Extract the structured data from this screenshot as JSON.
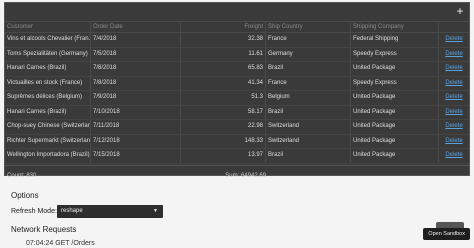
{
  "toolbar": {
    "add_label": "+"
  },
  "grid": {
    "columns": [
      "Customer",
      "Order Date",
      "Freight",
      "Ship Country",
      "Shipping Company",
      ""
    ],
    "rows": [
      {
        "customer": "Vins et alcools Chevalier (Fran...",
        "date": "7/4/2018",
        "freight": "32.38",
        "country": "France",
        "company": "Federal Shipping",
        "action": "Delete"
      },
      {
        "customer": "Toms Spezialitäten (Germany)",
        "date": "7/5/2018",
        "freight": "11.61",
        "country": "Germany",
        "company": "Speedy Express",
        "action": "Delete"
      },
      {
        "customer": "Hanari Carnes (Brazil)",
        "date": "7/8/2018",
        "freight": "65.83",
        "country": "Brazil",
        "company": "United Package",
        "action": "Delete"
      },
      {
        "customer": "Victuailles en stock (France)",
        "date": "7/8/2018",
        "freight": "41.34",
        "country": "France",
        "company": "Speedy Express",
        "action": "Delete"
      },
      {
        "customer": "Suprêmes délices (Belgium)",
        "date": "7/9/2018",
        "freight": "51.3",
        "country": "Belgium",
        "company": "United Package",
        "action": "Delete"
      },
      {
        "customer": "Hanari Carnes (Brazil)",
        "date": "7/10/2018",
        "freight": "58.17",
        "country": "Brazil",
        "company": "United Package",
        "action": "Delete"
      },
      {
        "customer": "Chop-suey Chinese (Switzerlan...",
        "date": "7/11/2018",
        "freight": "22.98",
        "country": "Switzerland",
        "company": "United Package",
        "action": "Delete"
      },
      {
        "customer": "Richter Supermarkt (Switzerlan...",
        "date": "7/12/2018",
        "freight": "148.33",
        "country": "Switzerland",
        "company": "United Package",
        "action": "Delete"
      },
      {
        "customer": "Wellington Importadora (Brazil)",
        "date": "7/15/2018",
        "freight": "13.97",
        "country": "Brazil",
        "company": "United Package",
        "action": "Delete"
      }
    ],
    "footer": {
      "count": "Count: 830",
      "sum": "Sum: 64942.69"
    }
  },
  "options": {
    "title": "Options",
    "refresh_label": "Refresh Mode:",
    "refresh_value": "reshape"
  },
  "network": {
    "title": "Network Requests",
    "line": "07:04:24 GET /Orders"
  },
  "sandbox": {
    "label": "Open Sandbox"
  }
}
